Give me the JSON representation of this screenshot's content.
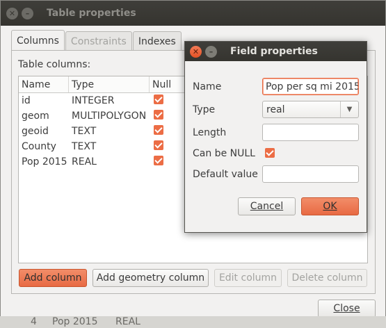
{
  "main_window": {
    "title": "Table properties",
    "tabs": [
      {
        "label": "Columns",
        "state": "active"
      },
      {
        "label": "Constraints",
        "state": "disabled"
      },
      {
        "label": "Indexes",
        "state": "normal"
      }
    ],
    "table_columns_label": "Table columns:",
    "list_headers": [
      "Name",
      "Type",
      "Null"
    ],
    "rows": [
      {
        "name": "id",
        "type": "INTEGER",
        "null": true
      },
      {
        "name": "geom",
        "type": "MULTIPOLYGON",
        "null": true
      },
      {
        "name": "geoid",
        "type": "TEXT",
        "null": true
      },
      {
        "name": "County",
        "type": "TEXT",
        "null": true
      },
      {
        "name": "Pop 2015",
        "type": "REAL",
        "null": true
      }
    ],
    "buttons": {
      "add_column": "Add column",
      "add_geometry_column": "Add geometry column",
      "edit_column": "Edit column",
      "delete_column": "Delete column",
      "close": "Close"
    },
    "background_row": {
      "col0": "4",
      "col1": "Pop 2015",
      "col2": "REAL"
    }
  },
  "dialog": {
    "title": "Field properties",
    "name_label": "Name",
    "name_value": "Pop per sq mi 2015",
    "type_label": "Type",
    "type_value": "real",
    "length_label": "Length",
    "length_value": "",
    "can_be_null_label": "Can be NULL",
    "can_be_null": true,
    "default_value_label": "Default value",
    "default_value": "",
    "cancel": "Cancel",
    "ok": "OK"
  },
  "colors": {
    "accent": "#e86a43",
    "titlebar": "#3c3b37",
    "window_bg": "#f2f1f0"
  }
}
